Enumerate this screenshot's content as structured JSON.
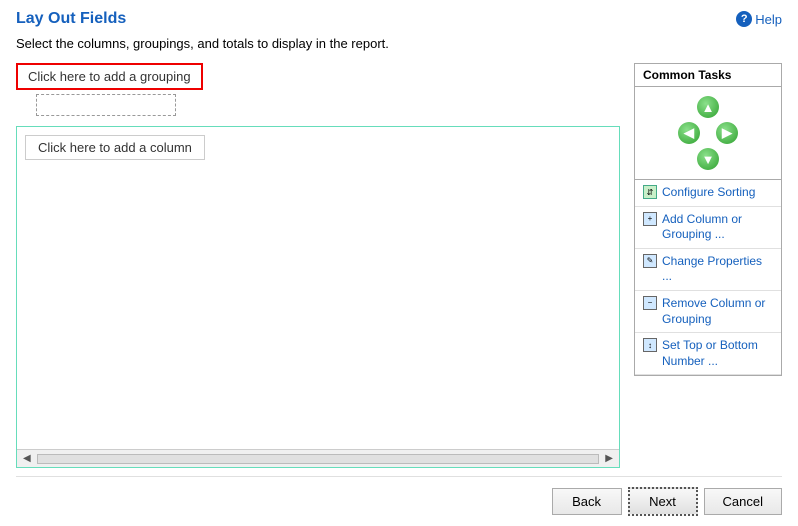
{
  "header": {
    "title": "Lay Out Fields",
    "help_label": "Help"
  },
  "subtitle": "Select the columns, groupings, and totals to display in the report.",
  "grouping": {
    "button_label": "Click here to add a grouping"
  },
  "column": {
    "button_label": "Click here to add a column"
  },
  "common_tasks": {
    "title": "Common Tasks",
    "items": [
      {
        "label": "Configure Sorting",
        "icon": "sort-icon"
      },
      {
        "label": "Add Column or\nGrouping ...",
        "icon": "add-col-icon"
      },
      {
        "label": "Change Properties ...",
        "icon": "change-prop-icon"
      },
      {
        "label": "Remove Column or\nGrouping",
        "icon": "remove-col-icon"
      },
      {
        "label": "Set Top or Bottom\nNumber ...",
        "icon": "topbottom-icon"
      }
    ]
  },
  "footer": {
    "back_label": "Back",
    "next_label": "Next",
    "cancel_label": "Cancel"
  }
}
